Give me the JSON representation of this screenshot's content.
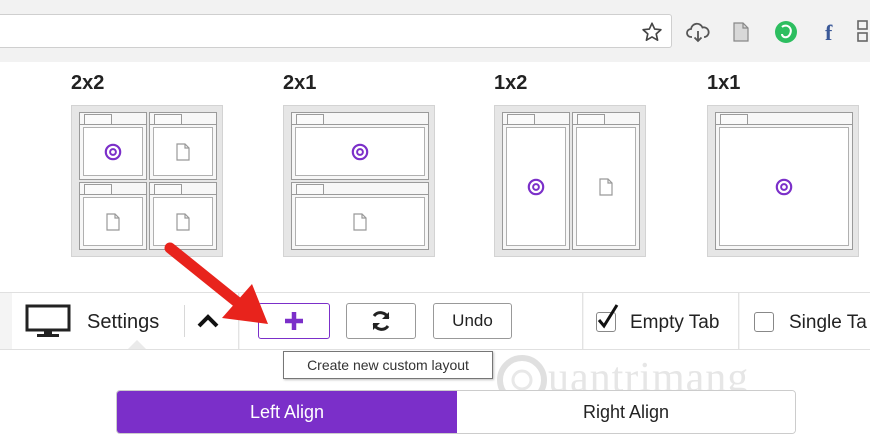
{
  "browser": {
    "extension_icons": [
      "star-icon",
      "cloud-download-icon",
      "page-icon",
      "evernote-icon",
      "facebook-icon",
      "extension-menu-icon"
    ]
  },
  "layouts": [
    {
      "label": "2x2"
    },
    {
      "label": "2x1"
    },
    {
      "label": "1x2"
    },
    {
      "label": "1x1"
    }
  ],
  "toolbar": {
    "settings_label": "Settings",
    "undo_label": "Undo",
    "empty_tab_label": "Empty Tab",
    "empty_tab_checked": true,
    "single_tab_label": "Single Ta",
    "single_tab_checked": false
  },
  "tooltip": {
    "text": "Create new custom layout"
  },
  "align": {
    "left_label": "Left Align",
    "right_label": "Right Align",
    "selected": "left"
  },
  "watermark": {
    "text": "uantrimang"
  },
  "colors": {
    "accent": "#7b2fc9",
    "arrow": "#e8231c"
  }
}
